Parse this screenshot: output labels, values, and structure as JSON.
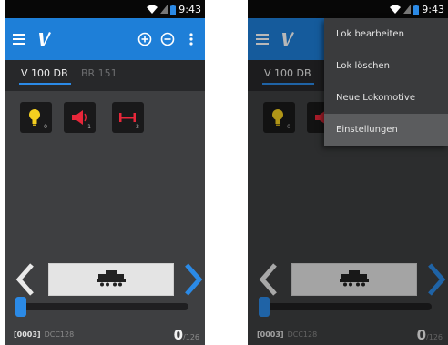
{
  "status": {
    "time": "9:43"
  },
  "app": {
    "logo_glyph": "V",
    "accent_color": "#1e7fd8"
  },
  "tabs": [
    {
      "label": "V 100 DB"
    },
    {
      "label": "BR 151"
    }
  ],
  "functions": [
    {
      "icon": "light-bulb-icon",
      "index": "0",
      "color": "#f5d020"
    },
    {
      "icon": "horn-icon",
      "index": "1",
      "color": "#e8273a"
    },
    {
      "icon": "coupler-icon",
      "index": "2",
      "color": "#e8273a"
    }
  ],
  "locomotive": {
    "address": "[0003]",
    "protocol": "DCC128",
    "speed": "0",
    "speed_max": "/126",
    "speed_fraction": 0
  },
  "overflow_menu": {
    "items": [
      {
        "label": "Lok bearbeiten"
      },
      {
        "label": "Lok löschen"
      },
      {
        "label": "Neue Lokomotive"
      },
      {
        "label": "Einstellungen"
      }
    ]
  }
}
